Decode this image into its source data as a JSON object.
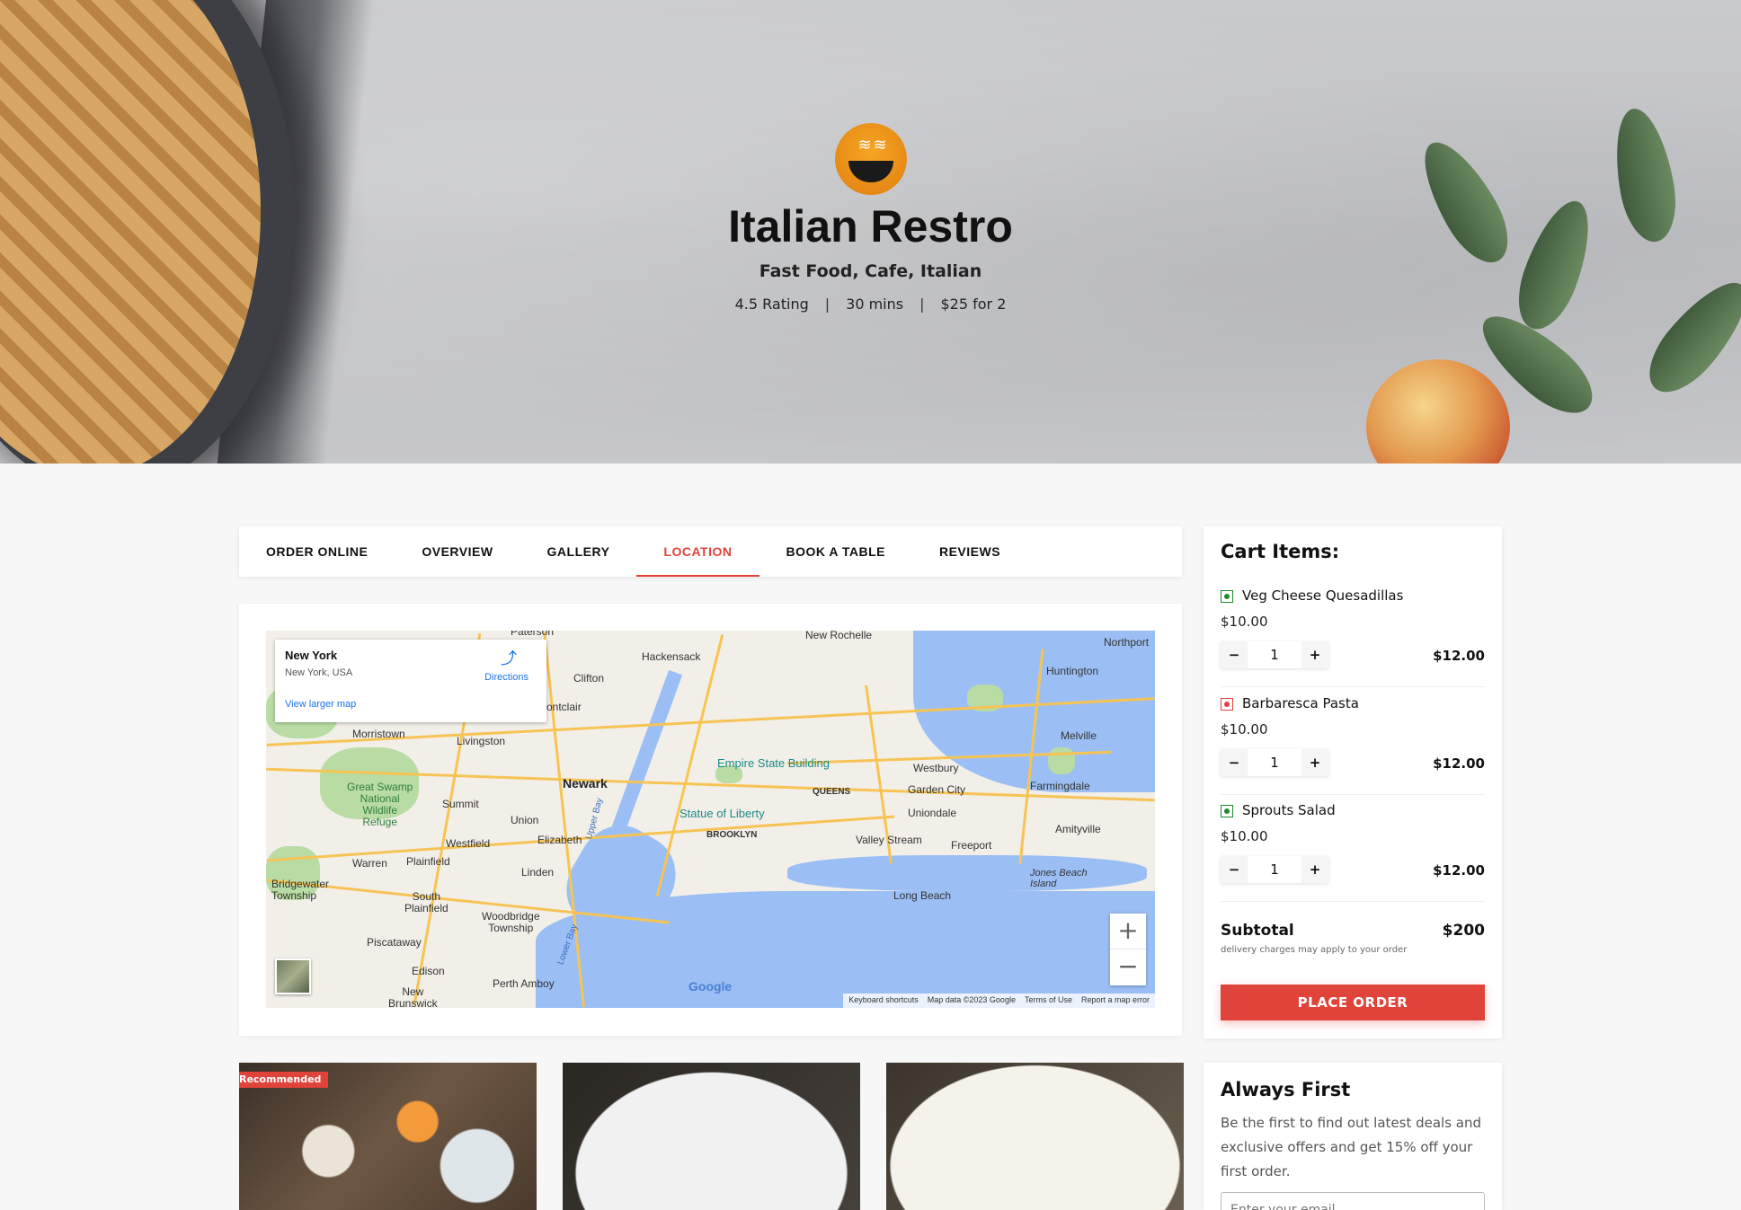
{
  "hero": {
    "title": "Italian Restro",
    "subtitle": "Fast Food, Cafe, Italian",
    "rating": "4.5 Rating",
    "time": "30 mins",
    "price": "$25 for 2",
    "separator": "|"
  },
  "tabs": [
    {
      "label": "ORDER ONLINE"
    },
    {
      "label": "OVERVIEW"
    },
    {
      "label": "GALLERY"
    },
    {
      "label": "LOCATION"
    },
    {
      "label": "BOOK A TABLE"
    },
    {
      "label": "REVIEWS"
    }
  ],
  "active_tab": "LOCATION",
  "map": {
    "place_title": "New York",
    "place_address": "New York, USA",
    "directions": "Directions",
    "view_larger": "View larger map",
    "google": "Google",
    "attribution": [
      "Keyboard shortcuts",
      "Map data ©2023 Google",
      "Terms of Use",
      "Report a map error"
    ],
    "labels": {
      "paterson": "Paterson",
      "hackensack": "Hackensack",
      "new_rochelle": "New Rochelle",
      "northport": "Northport",
      "huntington": "Huntington",
      "clifton": "Clifton",
      "montclair": "ontclair",
      "morristown": "Morristown",
      "livingston": "Livingston",
      "melville": "Melville",
      "newark": "Newark",
      "empire": "Empire State Building",
      "westbury": "Westbury",
      "farmingdale": "Farmingdale",
      "great_swamp": "Great Swamp\nNational\nWildlife\nRefuge",
      "summit": "Summit",
      "union": "Union",
      "queens": "QUEENS",
      "garden_city": "Garden City",
      "uniondale": "Uniondale",
      "statue": "Statue of Liberty",
      "brooklyn": "BROOKLYN",
      "amityville": "Amityville",
      "westfield": "Westfield",
      "elizabeth": "Elizabeth",
      "valley_stream": "Valley Stream",
      "freeport": "Freeport",
      "warren": "Warren",
      "plainfield": "Plainfield",
      "linden": "Linden",
      "upper_bay": "Upper Bay",
      "bridgewater": "Bridgewater\nTownship",
      "jones_beach": "Jones Beach\nIsland",
      "long_beach": "Long Beach",
      "south_plainfield": "South\nPlainfield",
      "woodbridge": "Woodbridge\nTownship",
      "piscataway": "Piscataway",
      "lower_bay": "Lower Bay",
      "edison": "Edison",
      "perth_amboy": "Perth Amboy",
      "new_brunswick": "New\nBrunswick"
    }
  },
  "cart": {
    "title": "Cart Items:",
    "items": [
      {
        "name": "Veg Cheese Quesadillas",
        "price": "$10.00",
        "qty": "1",
        "total": "$12.00",
        "type": "veg"
      },
      {
        "name": "Barbaresca Pasta",
        "price": "$10.00",
        "qty": "1",
        "total": "$12.00",
        "type": "nonveg"
      },
      {
        "name": "Sprouts Salad",
        "price": "$10.00",
        "qty": "1",
        "total": "$12.00",
        "type": "veg"
      }
    ],
    "minus": "−",
    "plus": "+",
    "subtotal_label": "Subtotal",
    "subtotal_value": "$200",
    "note": "delivery charges may apply to your order",
    "place_order": "PLACE ORDER"
  },
  "photos": {
    "badge": "Recommended"
  },
  "newsletter": {
    "title": "Always First",
    "text": "Be the first to find out latest deals and exclusive offers and get 15% off your first order.",
    "placeholder": "Enter your email"
  },
  "colors": {
    "accent": "#e0433a",
    "veg": "#1e8c2f",
    "link": "#1a73e8"
  }
}
